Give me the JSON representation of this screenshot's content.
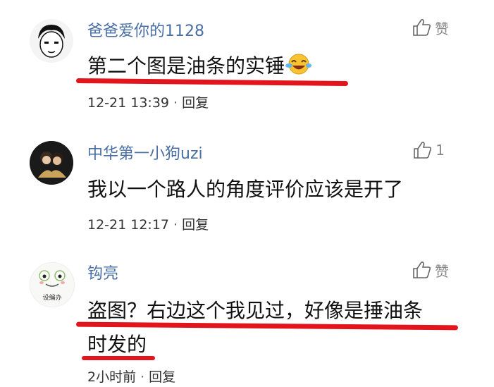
{
  "comments": [
    {
      "username": "爸爸爱你的1128",
      "like_label": "赞",
      "content": "第二个图是油条的实锤",
      "time": "12-21 13:39",
      "dot": "·",
      "reply": "回复"
    },
    {
      "username": "中华第一小狗uzi",
      "like_label": "1",
      "content": "我以一个路人的角度评价应该是开了",
      "time": "12-21 12:17",
      "dot": "·",
      "reply": "回复"
    },
    {
      "username": "钩亮",
      "like_label": "赞",
      "content_line1": "盗图？右边这个我见过，好像是捶油条",
      "content_line2": "时发的",
      "time": "2小时前",
      "dot": "·",
      "reply": "回复",
      "avatar_text": "设编办"
    }
  ],
  "colors": {
    "username": "#4a6fa5",
    "annotation": "#e1151b",
    "text": "#111111",
    "muted": "#888888"
  }
}
